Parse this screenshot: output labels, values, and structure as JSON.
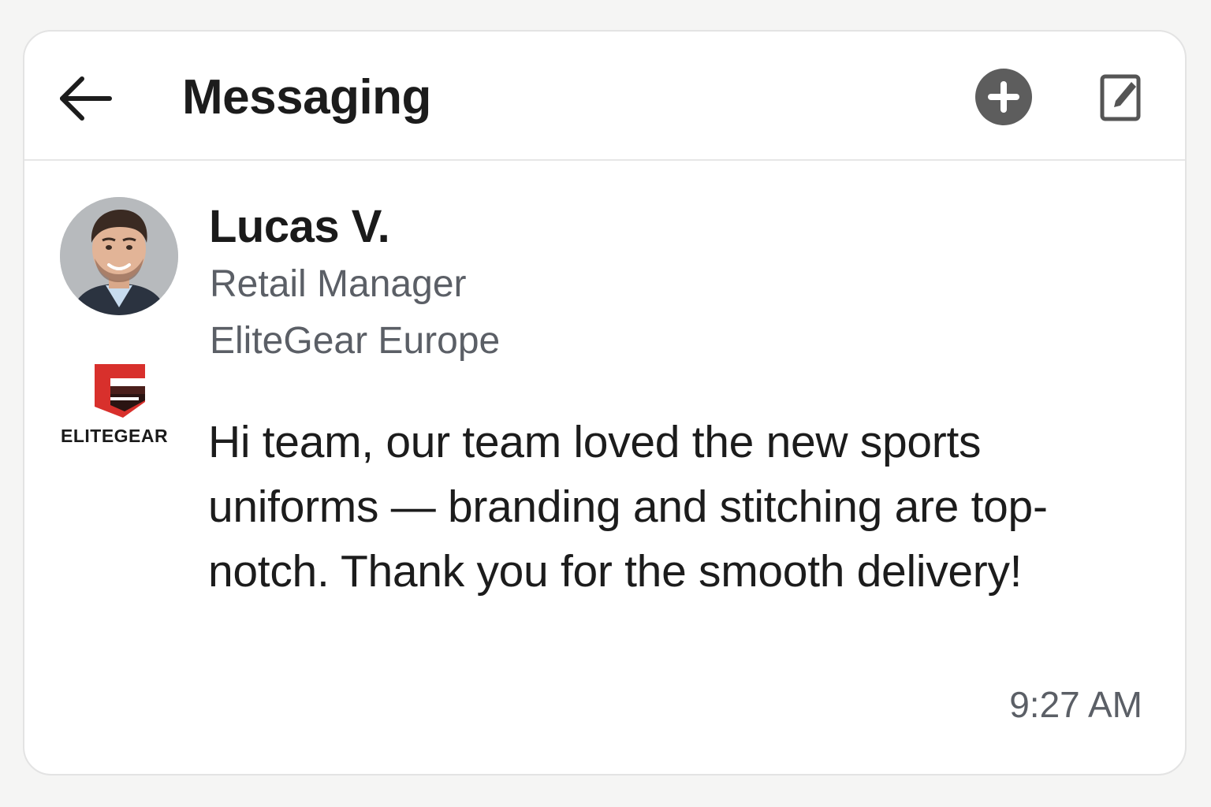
{
  "header": {
    "title": "Messaging",
    "back_icon": "arrow-left-icon",
    "add_icon": "plus-circle-icon",
    "compose_icon": "compose-icon"
  },
  "message": {
    "sender": {
      "name": "Lucas V.",
      "role": "Retail Manager",
      "company": "EliteGear Europe",
      "avatar": "profile-photo"
    },
    "company_logo": {
      "text": "ELITEGEAR",
      "colors": {
        "red": "#d8302c",
        "dark_red": "#4a1f1b"
      }
    },
    "body": "Hi team, our team loved the new sports uniforms — branding and stitching are top-notch. Thank you for the smooth delivery!",
    "time": "9:27 AM"
  },
  "colors": {
    "background": "#f5f5f4",
    "card": "#ffffff",
    "primary_text": "#1c1c1c",
    "secondary_text": "#5b5f66",
    "icon_dark": "#5d5d5d"
  }
}
